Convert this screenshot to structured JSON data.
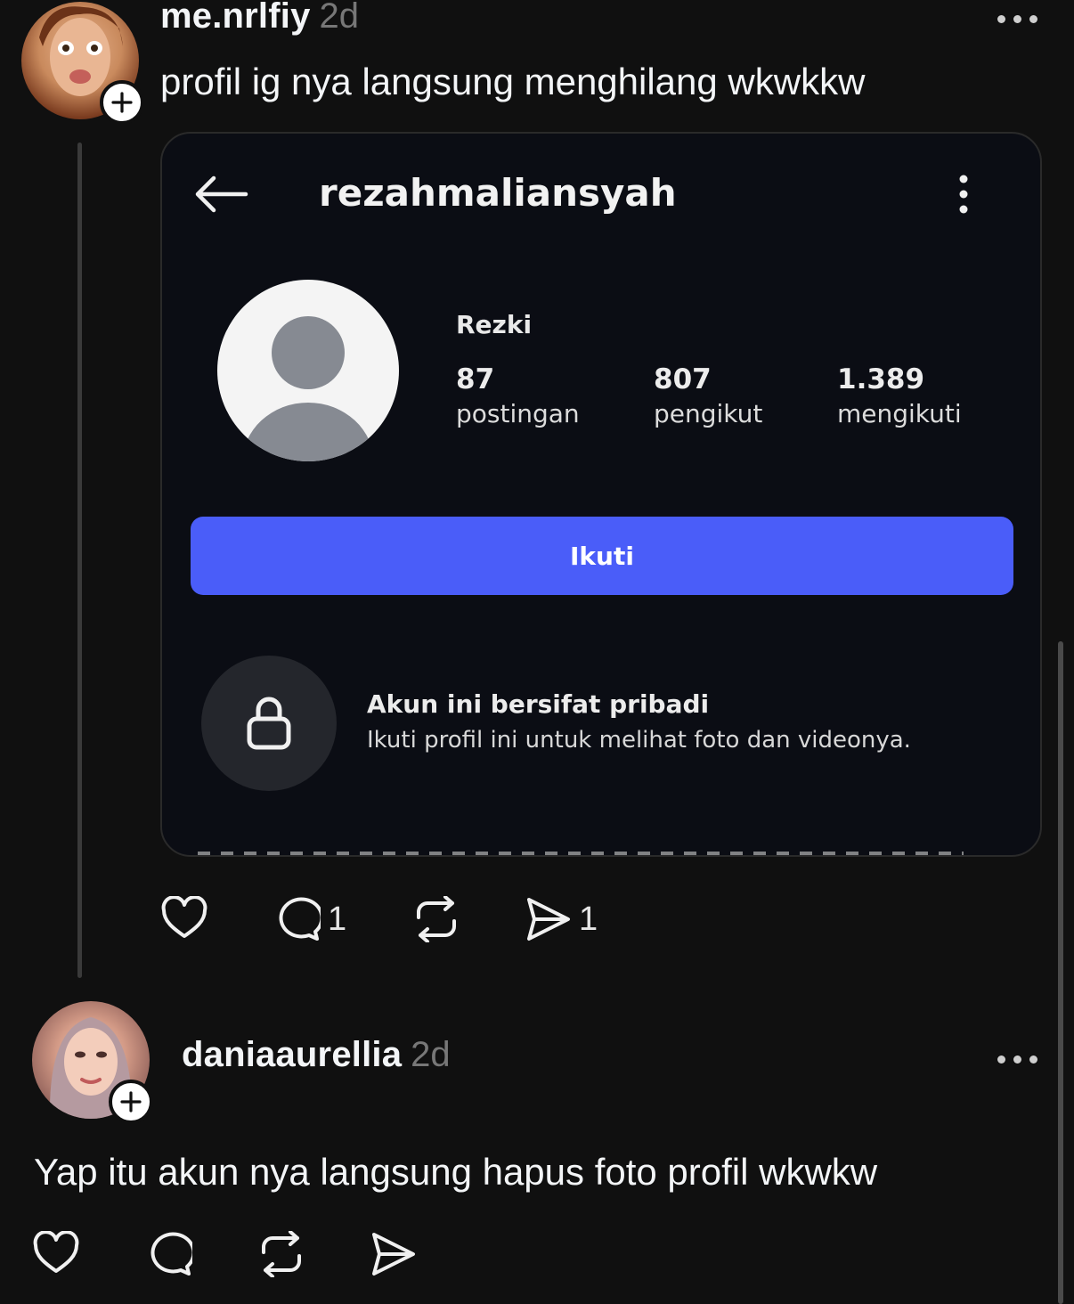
{
  "posts": [
    {
      "username": "me.nrlfiy",
      "time": "2d",
      "text": "profil ig nya langsung menghilang wkwkkw",
      "actions": {
        "like_count": "",
        "reply_count": "1",
        "repost_count": "",
        "share_count": "1"
      }
    },
    {
      "username": "daniaaurellia",
      "time": "2d",
      "text": "Yap itu akun nya langsung hapus foto profil wkwkw",
      "actions": {
        "like_count": "",
        "reply_count": "",
        "repost_count": "",
        "share_count": ""
      }
    }
  ],
  "embed": {
    "ig_username": "rezahmaliansyah",
    "display_name": "Rezki",
    "stats": [
      {
        "value": "87",
        "label": "postingan"
      },
      {
        "value": "807",
        "label": "pengikut"
      },
      {
        "value": "1.389",
        "label": "mengikuti"
      }
    ],
    "follow_label": "Ikuti",
    "private_title": "Akun ini bersifat pribadi",
    "private_subtitle": "Ikuti profil ini untuk melihat foto dan videonya."
  },
  "colors": {
    "background": "#101010",
    "follow_button": "#4a5df9",
    "timestamp": "#777777"
  },
  "icons": [
    "plus-icon",
    "more-icon",
    "back-arrow-icon",
    "kebab-icon",
    "default-avatar-icon",
    "lock-icon",
    "heart-icon",
    "comment-icon",
    "repost-icon",
    "share-icon"
  ]
}
